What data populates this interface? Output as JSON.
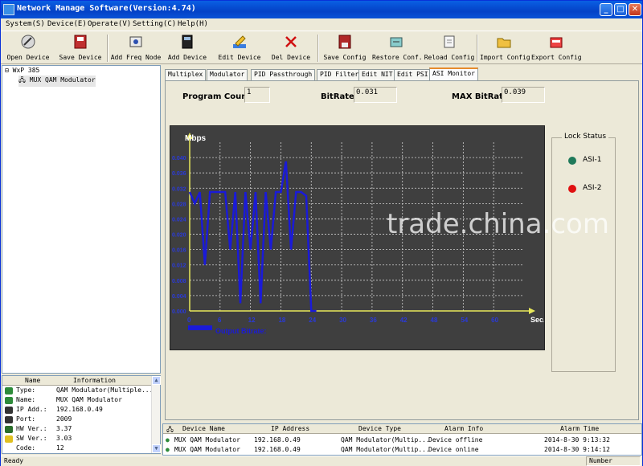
{
  "window": {
    "title": "Network Manage Software(Version:4.74)",
    "minimize_glyph": "_",
    "maximize_glyph": "□",
    "close_glyph": "✕"
  },
  "menu": [
    "System(S)",
    "Device(E)",
    "Operate(V)",
    "Setting(C)",
    "Help(H)"
  ],
  "toolbar": [
    {
      "label": "Open Device",
      "icon": "open-device-icon"
    },
    {
      "label": "Save Device",
      "icon": "save-device-icon"
    },
    {
      "label": "Add Freq Node",
      "icon": "add-freq-node-icon"
    },
    {
      "label": "Add Device",
      "icon": "add-device-icon"
    },
    {
      "label": "Edit Device",
      "icon": "edit-device-icon"
    },
    {
      "label": "Del Device",
      "icon": "delete-icon"
    },
    {
      "label": "Save Config",
      "icon": "save-config-icon"
    },
    {
      "label": "Restore Conf.",
      "icon": "restore-config-icon"
    },
    {
      "label": "Reload Config",
      "icon": "reload-config-icon"
    },
    {
      "label": "Import Config",
      "icon": "import-config-icon"
    },
    {
      "label": "Export Config",
      "icon": "export-config-icon"
    }
  ],
  "tree": {
    "root_label": "WxP 385",
    "device_label": "MUX QAM Modulator"
  },
  "info_panel": {
    "headers": {
      "name": "Name",
      "information": "Information"
    },
    "rows": [
      {
        "key": "Type:",
        "value": "QAM Modulator(Multiple..."
      },
      {
        "key": "Name:",
        "value": "MUX QAM Modulator"
      },
      {
        "key": "IP Add.:",
        "value": "192.168.0.49"
      },
      {
        "key": "Port:",
        "value": "2009"
      },
      {
        "key": "HW Ver.:",
        "value": "3.37"
      },
      {
        "key": "SW Ver.:",
        "value": "3.03"
      },
      {
        "key": "Code:",
        "value": "12"
      }
    ]
  },
  "tabs": [
    "Multiplex",
    "Modulator",
    "PID Passthrough",
    "PID Filter",
    "Edit NIT",
    "Edit PSI",
    "ASI Monitor"
  ],
  "active_tab": 6,
  "asi_monitor": {
    "program_count_label": "Program Count:",
    "program_count": "1",
    "bitrate_label": "BitRate:",
    "bitrate": "0.031",
    "max_bitrate_label": "MAX BitRate:",
    "max_bitrate": "0.039",
    "lock_status_label": "Lock Status",
    "asi1_label": "ASI-1",
    "asi2_label": "ASI-2",
    "asi1_color": "#1f7a5a",
    "asi2_color": "#e01010"
  },
  "chart_data": {
    "type": "line",
    "ylabel": "Mbps",
    "xlabel": "Sec.",
    "legend": "Output Bitrate:",
    "x_ticks": [
      "0",
      "6",
      "12",
      "18",
      "24",
      "30",
      "36",
      "42",
      "48",
      "54",
      "60"
    ],
    "y_ticks": [
      "0.040",
      "0.036",
      "0.032",
      "0.028",
      "0.024",
      "0.020",
      "0.016",
      "0.012",
      "0.008",
      "0.004",
      "0.000"
    ],
    "xlim": [
      0,
      66
    ],
    "ylim": [
      0,
      0.044
    ],
    "grid": true,
    "background": "#3f3f3f",
    "axis_color": "#e8e85a",
    "line_color": "#1a1ad8",
    "series": [
      {
        "x": [
          0,
          1,
          2,
          3,
          4,
          5,
          6,
          7,
          8,
          9,
          10,
          11,
          12,
          13,
          14,
          15,
          16,
          17,
          18,
          19,
          20,
          21,
          22,
          23,
          24,
          25
        ],
        "values": [
          0.031,
          0.028,
          0.031,
          0.012,
          0.031,
          0.031,
          0.031,
          0.031,
          0.016,
          0.031,
          0.002,
          0.031,
          0.016,
          0.031,
          0.002,
          0.031,
          0.016,
          0.031,
          0.031,
          0.039,
          0.016,
          0.031,
          0.031,
          0.03,
          0.0,
          0.0
        ]
      }
    ]
  },
  "alarm_panel": {
    "headers": [
      "Device Name",
      "IP Address",
      "Device Type",
      "Alarm Info",
      "Alarm Time"
    ],
    "rows": [
      {
        "device": "MUX QAM Modulator",
        "ip": "192.168.0.49",
        "type": "QAM Modulator(Multip...",
        "info": "Device offline",
        "time": "2014-8-30 9:13:32"
      },
      {
        "device": "MUX QAM Modulator",
        "ip": "192.168.0.49",
        "type": "QAM Modulator(Multip...",
        "info": "Device online",
        "time": "2014-8-30 9:14:12"
      }
    ]
  },
  "statusbar": {
    "left": "Ready",
    "right": "Number"
  },
  "watermark": "trade.china.com"
}
